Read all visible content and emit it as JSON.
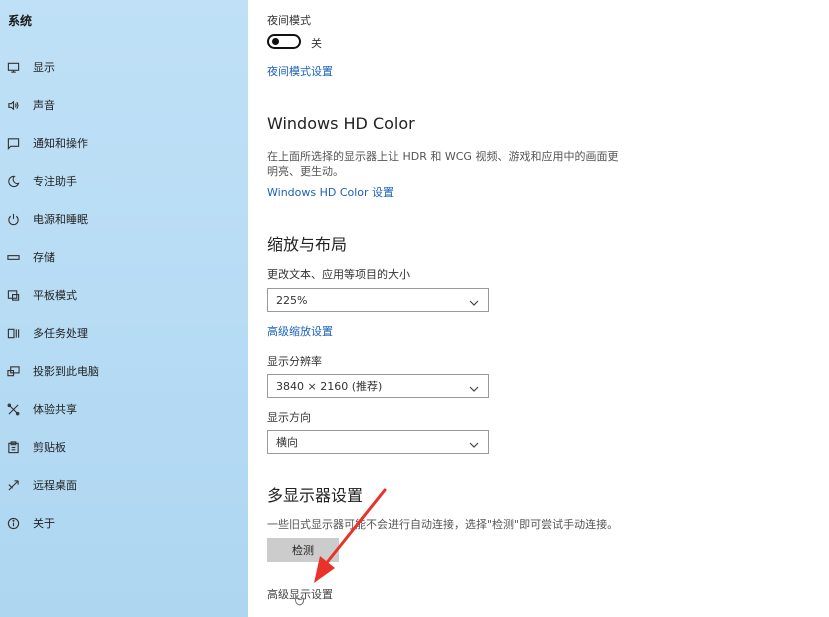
{
  "sidebar": {
    "title": "系统",
    "items": [
      {
        "label": "显示",
        "icon": "monitor-icon"
      },
      {
        "label": "声音",
        "icon": "speaker-icon"
      },
      {
        "label": "通知和操作",
        "icon": "notification-icon"
      },
      {
        "label": "专注助手",
        "icon": "moon-icon"
      },
      {
        "label": "电源和睡眠",
        "icon": "power-icon"
      },
      {
        "label": "存储",
        "icon": "storage-icon"
      },
      {
        "label": "平板模式",
        "icon": "tablet-icon"
      },
      {
        "label": "多任务处理",
        "icon": "multitask-icon"
      },
      {
        "label": "投影到此电脑",
        "icon": "project-icon"
      },
      {
        "label": "体验共享",
        "icon": "share-icon"
      },
      {
        "label": "剪贴板",
        "icon": "clipboard-icon"
      },
      {
        "label": "远程桌面",
        "icon": "remote-desktop-icon"
      },
      {
        "label": "关于",
        "icon": "info-icon"
      }
    ]
  },
  "main": {
    "night_light": {
      "label": "夜间模式",
      "toggle_state": "关",
      "settings_link": "夜间模式设置"
    },
    "hd_color": {
      "title": "Windows HD Color",
      "description": "在上面所选择的显示器上让 HDR 和 WCG 视频、游戏和应用中的画面更明亮、更生动。",
      "link": "Windows HD Color 设置"
    },
    "scale_layout": {
      "title": "缩放与布局",
      "scale_label": "更改文本、应用等项目的大小",
      "scale_value": "225%",
      "advanced_scaling_link": "高级缩放设置",
      "resolution_label": "显示分辨率",
      "resolution_value": "3840 × 2160 (推荐)",
      "orientation_label": "显示方向",
      "orientation_value": "横向"
    },
    "multi_display": {
      "title": "多显示器设置",
      "description": "一些旧式显示器可能不会进行自动连接，选择\"检测\"即可尝试手动连接。",
      "detect_button": "检测",
      "advanced_link": "高级显示设置"
    }
  },
  "colors": {
    "sidebar_bg": "#b9ddf5",
    "link": "#1a62b8",
    "annotation_arrow": "#e8322a"
  }
}
